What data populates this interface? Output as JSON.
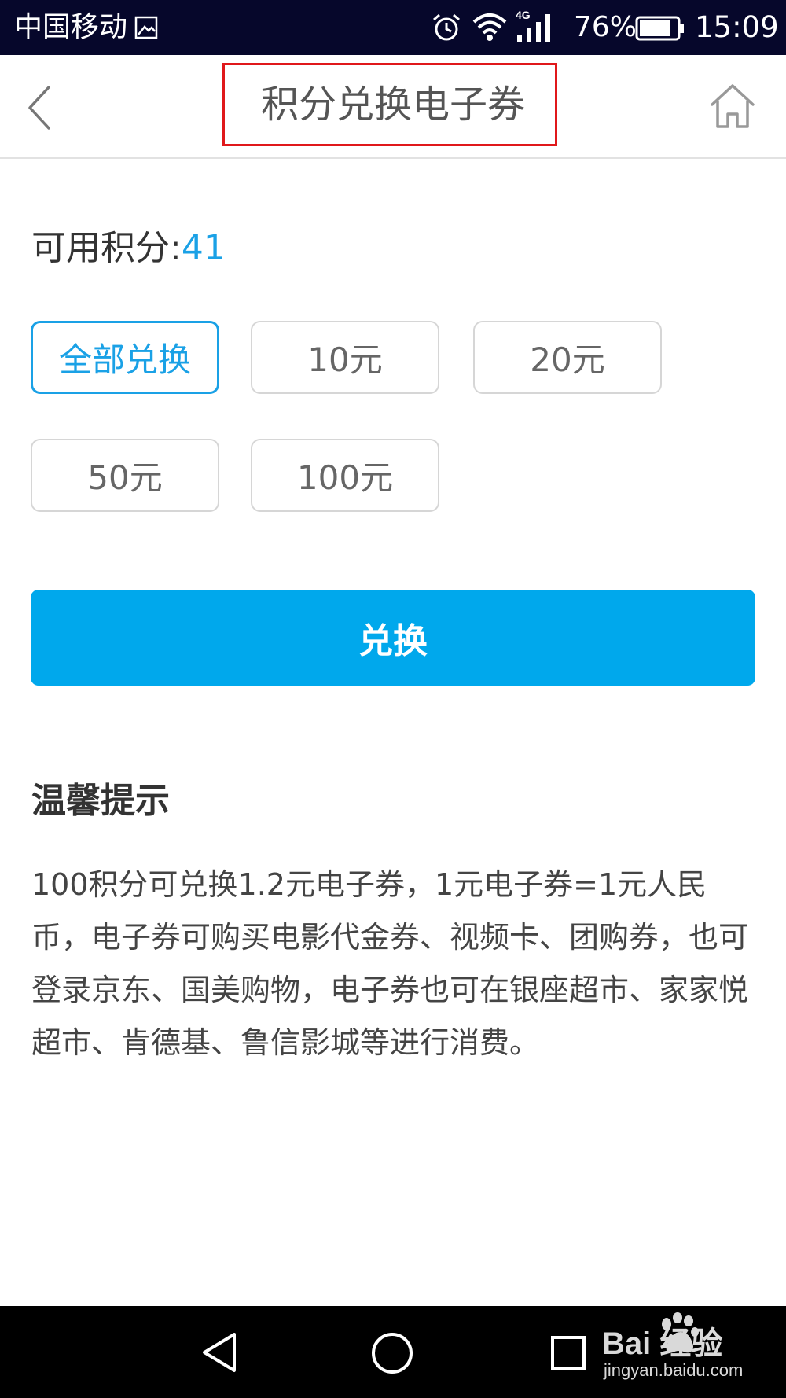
{
  "status_bar": {
    "carrier": "中国移动",
    "network": "4G",
    "battery_percent": "76%",
    "time": "15:09"
  },
  "header": {
    "title": "积分兑换电子券",
    "highlight_color": "#e0181b"
  },
  "points": {
    "label": "可用积分:",
    "value": "41"
  },
  "options": [
    {
      "label": "全部兑换",
      "selected": true
    },
    {
      "label": "10元",
      "selected": false
    },
    {
      "label": "20元",
      "selected": false
    },
    {
      "label": "50元",
      "selected": false
    },
    {
      "label": "100元",
      "selected": false
    }
  ],
  "exchange_button": {
    "label": "兑换"
  },
  "tips": {
    "title": "温馨提示",
    "body": "100积分可兑换1.2元电子券，1元电子券=1元人民币，电子券可购买电影代金券、视频卡、团购券，也可登录京东、国美购物，电子券也可在银座超市、家家悦超市、肯德基、鲁信影城等进行消费。"
  },
  "watermark": {
    "brand": "Bai  经验",
    "url": "jingyan.baidu.com"
  },
  "colors": {
    "accent": "#1aa1e6",
    "button": "#00a8ec",
    "status_bar": "#06072b"
  },
  "icons": [
    "back-arrow-icon",
    "home-icon",
    "alarm-icon",
    "wifi-icon",
    "signal-icon",
    "battery-icon",
    "nav-back-icon",
    "nav-home-icon",
    "nav-recent-icon"
  ]
}
